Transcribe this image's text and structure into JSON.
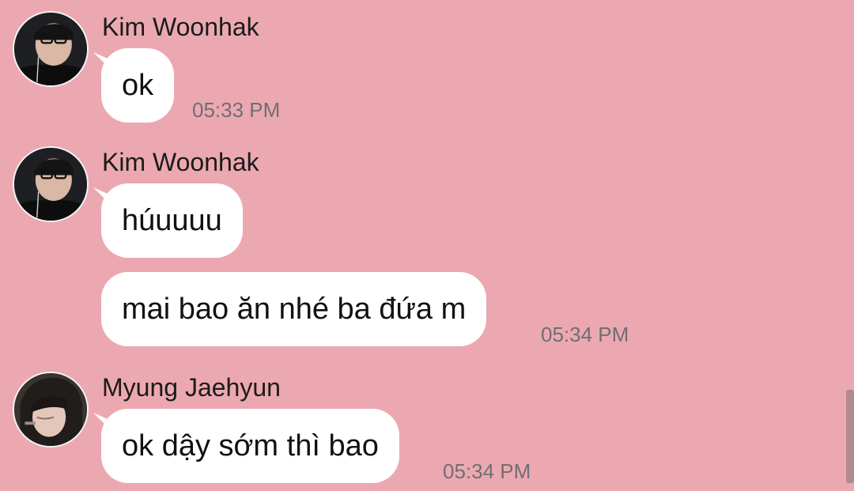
{
  "messages": [
    {
      "sender": "Kim Woonhak",
      "text": "ok",
      "time": "05:33 PM"
    },
    {
      "sender": "Kim Woonhak",
      "text": "húuuuu",
      "time": ""
    },
    {
      "sender": "",
      "text": "mai bao ăn nhé ba đứa m",
      "time": "05:34 PM"
    },
    {
      "sender": "Myung Jaehyun",
      "text": "ok dậy sớm thì bao",
      "time": "05:34 PM"
    }
  ],
  "colors": {
    "background": "#eca8b1",
    "bubble": "#ffffff",
    "timestamp": "#6e6f73"
  },
  "icons": {
    "avatar_1": "avatar-kim-woonhak",
    "avatar_2": "avatar-myung-jaehyun"
  }
}
